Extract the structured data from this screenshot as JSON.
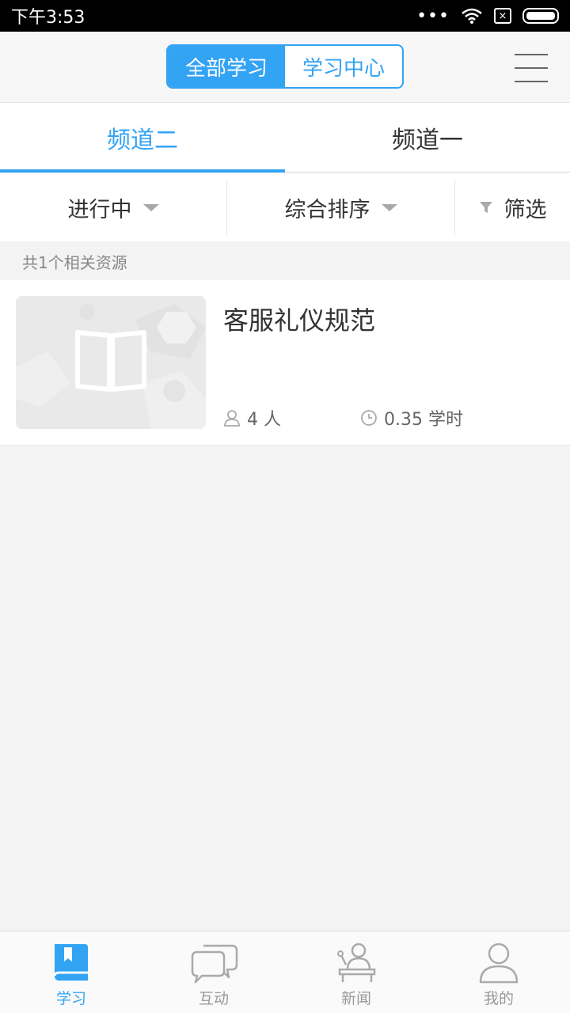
{
  "status_bar": {
    "time": "下午3:53",
    "dots": "•••",
    "sim": "×"
  },
  "header": {
    "segments": [
      {
        "label": "全部学习",
        "active": true
      },
      {
        "label": "学习中心",
        "active": false
      }
    ],
    "menu_icon": "hamburger-icon"
  },
  "channel_tabs": [
    {
      "label": "频道二",
      "active": true
    },
    {
      "label": "频道一",
      "active": false
    }
  ],
  "filters": {
    "status": "进行中",
    "sort": "综合排序",
    "filter": "筛选"
  },
  "result_count": "共1个相关资源",
  "courses": [
    {
      "title": "客服礼仪规范",
      "learners": "4 人",
      "hours": "0.35 学时"
    }
  ],
  "bottom_nav": [
    {
      "label": "学习",
      "icon": "book-icon",
      "active": true
    },
    {
      "label": "互动",
      "icon": "chat-bubbles-icon",
      "active": false
    },
    {
      "label": "新闻",
      "icon": "news-anchor-icon",
      "active": false
    },
    {
      "label": "我的",
      "icon": "profile-icon",
      "active": false
    }
  ],
  "colors": {
    "accent": "#33a3f4",
    "background": "#f3f3f3"
  }
}
